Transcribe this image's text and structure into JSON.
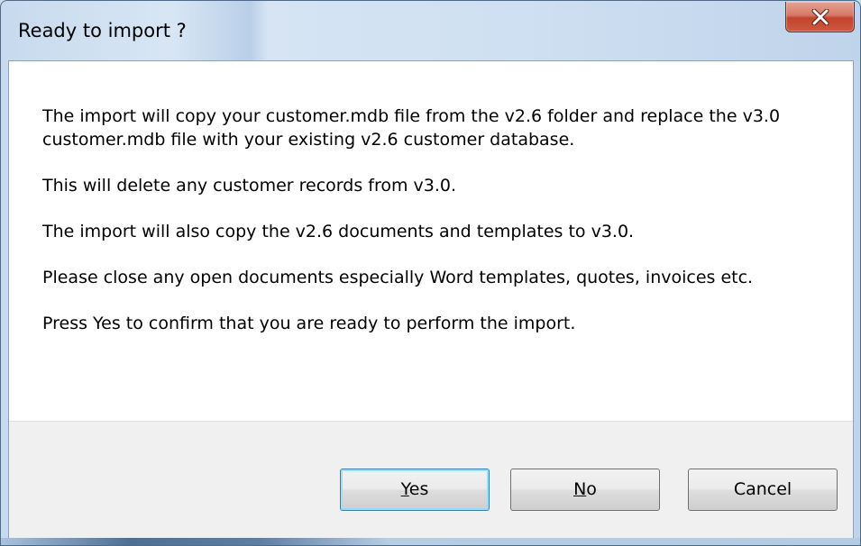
{
  "dialog": {
    "title": "Ready to import ?",
    "message": [
      "The import will copy your customer.mdb file from the v2.6 folder and replace the v3.0 customer.mdb file with your existing v2.6 customer database.",
      "This will delete any customer records from v3.0.",
      "The import will also copy the v2.6 documents and templates to v3.0.",
      "Please close any open documents especially Word templates, quotes, invoices etc.",
      "Press Yes to confirm that you are ready to perform the import."
    ],
    "buttons": {
      "yes_mnemonic": "Y",
      "yes_rest": "es",
      "no_mnemonic": "N",
      "no_rest": "o",
      "cancel": "Cancel"
    },
    "icons": {
      "close": "close-icon"
    }
  }
}
